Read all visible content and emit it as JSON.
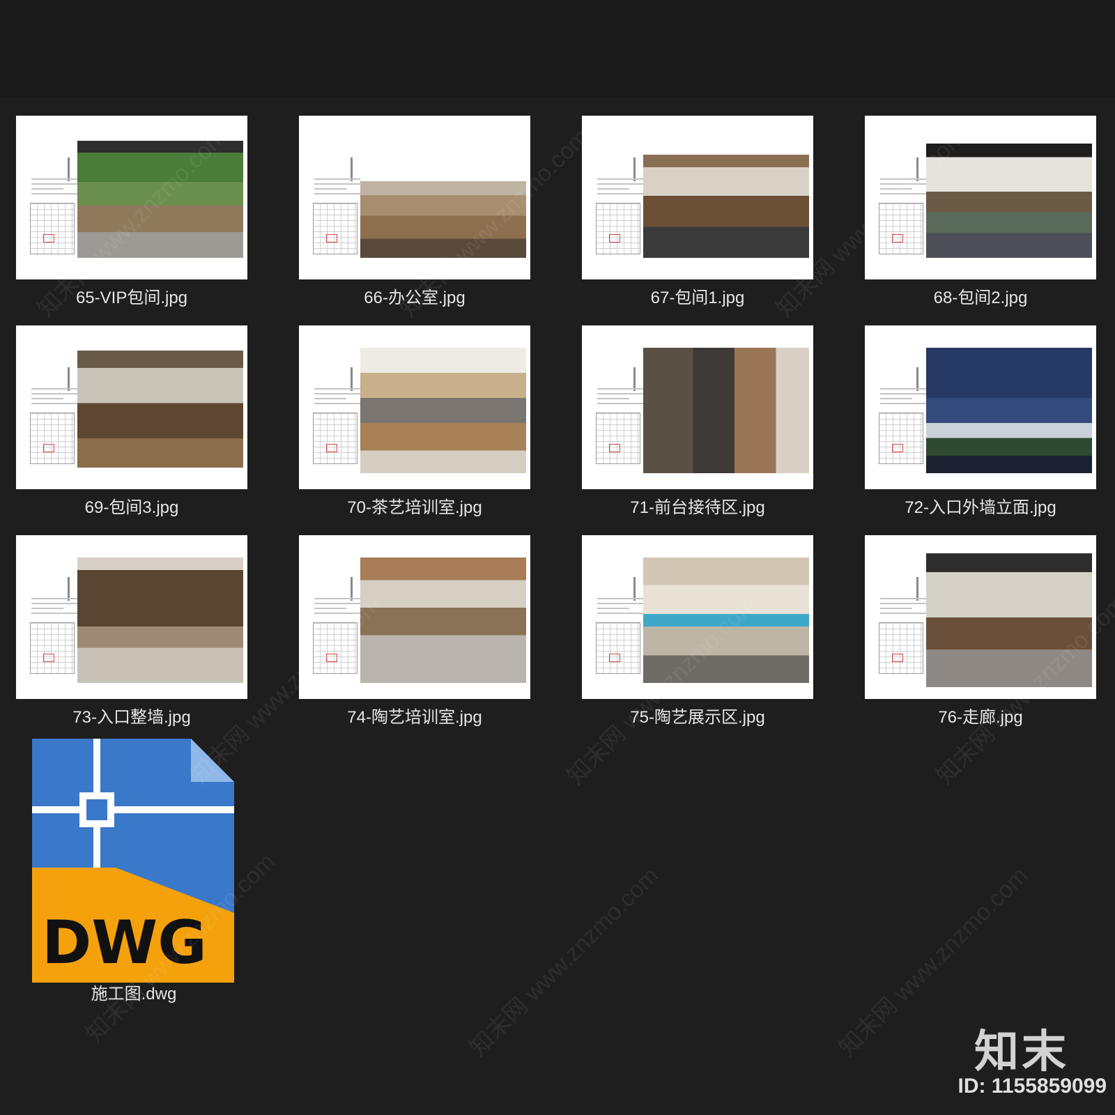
{
  "files": [
    {
      "label": "65-VIP包间.jpg",
      "icon": "image-thumbnail-icon"
    },
    {
      "label": "66-办公室.jpg",
      "icon": "image-thumbnail-icon"
    },
    {
      "label": "67-包间1.jpg",
      "icon": "image-thumbnail-icon"
    },
    {
      "label": "68-包间2.jpg",
      "icon": "image-thumbnail-icon"
    },
    {
      "label": "69-包间3.jpg",
      "icon": "image-thumbnail-icon"
    },
    {
      "label": "70-茶艺培训室.jpg",
      "icon": "image-thumbnail-icon"
    },
    {
      "label": "71-前台接待区.jpg",
      "icon": "image-thumbnail-icon"
    },
    {
      "label": "72-入口外墙立面.jpg",
      "icon": "image-thumbnail-icon"
    },
    {
      "label": "73-入口整墙.jpg",
      "icon": "image-thumbnail-icon"
    },
    {
      "label": "74-陶艺培训室.jpg",
      "icon": "image-thumbnail-icon"
    },
    {
      "label": "75-陶艺展示区.jpg",
      "icon": "image-thumbnail-icon"
    },
    {
      "label": "76-走廊.jpg",
      "icon": "image-thumbnail-icon"
    }
  ],
  "dwg_file": {
    "label": "施工图.dwg",
    "icon": "dwg-file-icon",
    "badge_text": "DWG",
    "colors": {
      "blue": "#3a78c9",
      "orange": "#f5a10c"
    }
  },
  "watermark": {
    "text": "知末网 www.znzmo.com"
  },
  "branding": {
    "logo_text": "知末",
    "id_text": "ID: 1155859099"
  }
}
